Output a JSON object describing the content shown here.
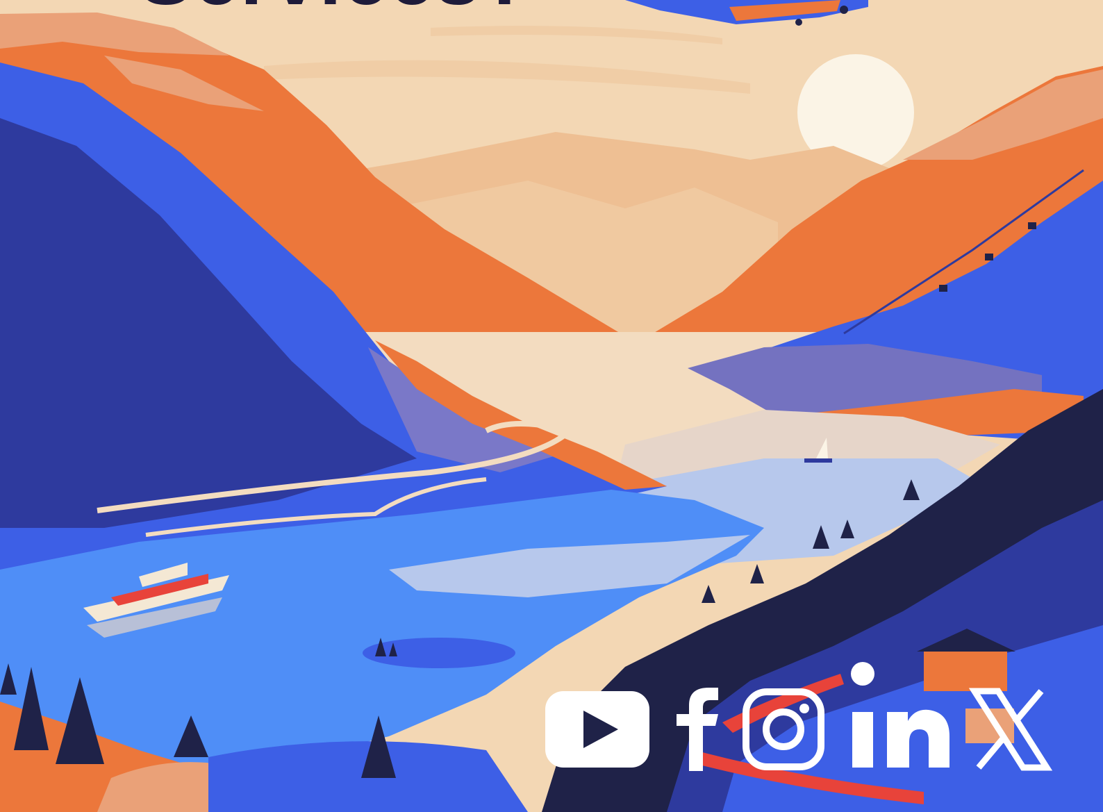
{
  "headline": "Services?",
  "colors": {
    "sky": "#f3d7b4",
    "sun": "#fbf4e6",
    "orange": "#ec773b",
    "peach": "#eaa178",
    "blue": "#3d5fe6",
    "deep_blue": "#2e3a9e",
    "navy": "#1f2248",
    "water": "#4f8ef7",
    "white": "#ffffff"
  },
  "social_icons": [
    "youtube-icon",
    "facebook-icon",
    "instagram-icon",
    "linkedin-icon",
    "x-icon"
  ]
}
